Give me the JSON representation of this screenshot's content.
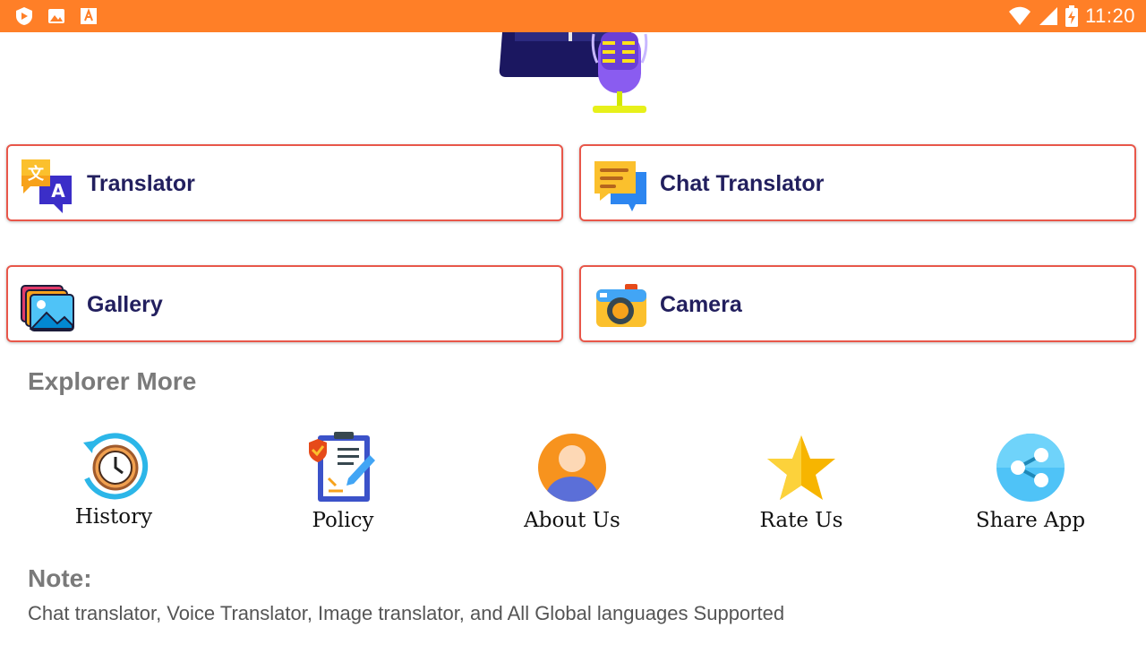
{
  "status_bar": {
    "time": "11:20",
    "left_icons": [
      "shield-icon",
      "image-icon",
      "font-icon"
    ],
    "right_icons": [
      "wifi-icon",
      "signal-icon",
      "battery-charging-icon"
    ]
  },
  "hero": {
    "icon": "book-microphone-illustration"
  },
  "cards": [
    {
      "label": "Translator",
      "icon": "translate-icon"
    },
    {
      "label": "Chat Translator",
      "icon": "chat-bubbles-icon"
    },
    {
      "label": "Gallery",
      "icon": "gallery-icon"
    },
    {
      "label": "Camera",
      "icon": "camera-icon"
    }
  ],
  "explore": {
    "title": "Explorer More",
    "items": [
      {
        "label": "History",
        "icon": "history-clock-icon"
      },
      {
        "label": "Policy",
        "icon": "policy-clipboard-icon"
      },
      {
        "label": "About Us",
        "icon": "about-user-icon"
      },
      {
        "label": "Rate Us",
        "icon": "star-icon"
      },
      {
        "label": "Share App",
        "icon": "share-icon"
      }
    ]
  },
  "note": {
    "title": "Note:",
    "body": "Chat translator, Voice Translator, Image translator, and All Global languages Supported"
  },
  "colors": {
    "status_bar": "#ff7f27",
    "card_border": "#e8574a",
    "card_text": "#221f5e",
    "section_text": "#7a7a7a"
  }
}
